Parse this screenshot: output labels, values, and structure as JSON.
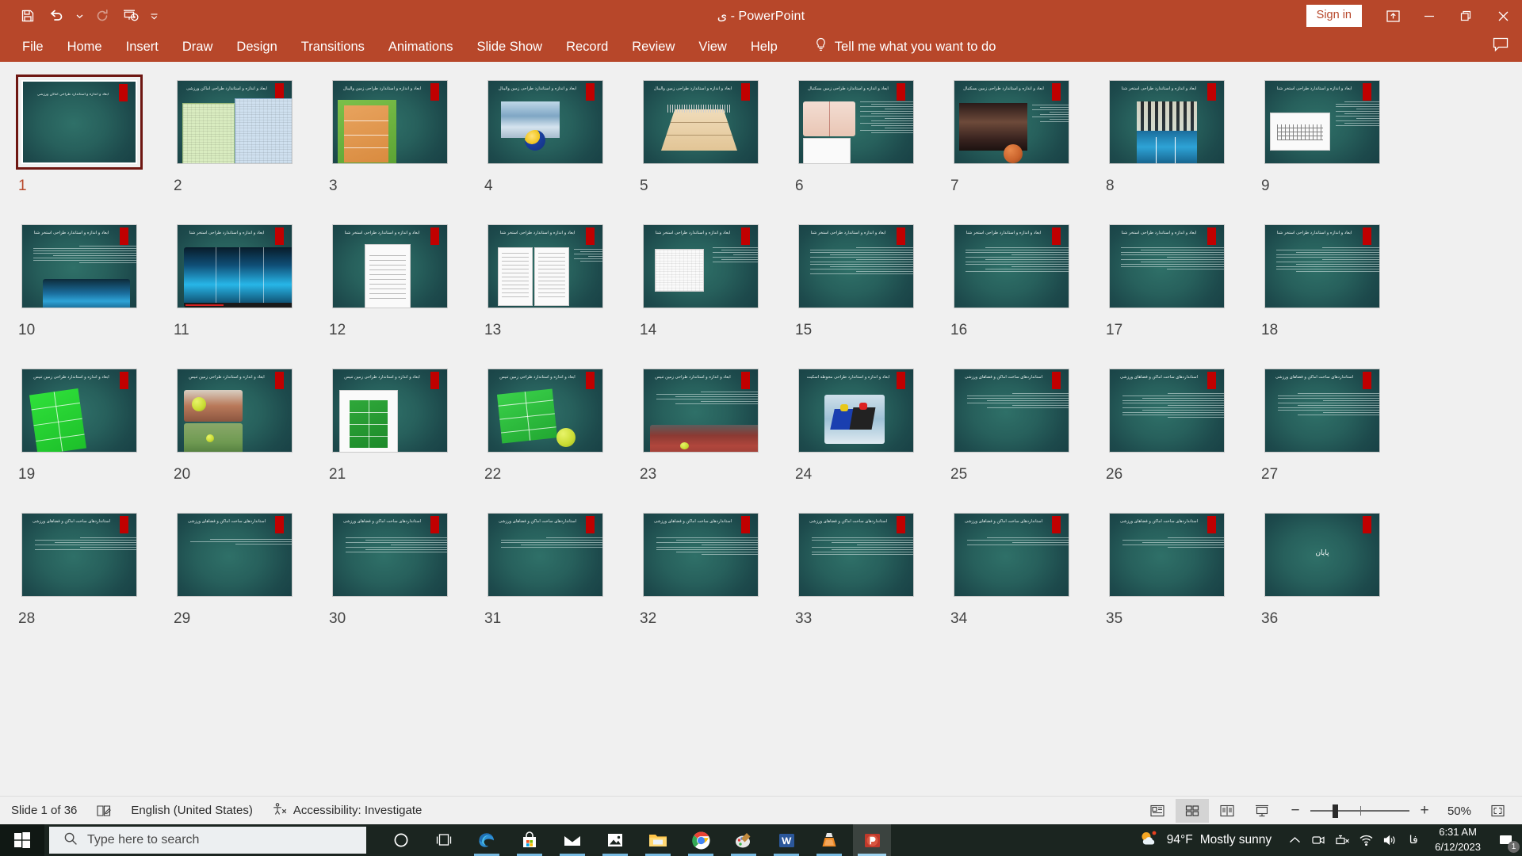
{
  "titlebar": {
    "document_title": "ى  -  PowerPoint",
    "signin_label": "Sign in",
    "qat": [
      {
        "name": "save-icon",
        "label": "Save"
      },
      {
        "name": "undo-icon",
        "label": "Undo"
      },
      {
        "name": "undo-dropdown-icon",
        "label": "Undo options"
      },
      {
        "name": "redo-icon",
        "label": "Redo"
      },
      {
        "name": "start-presentation-icon",
        "label": "Start From Beginning"
      },
      {
        "name": "customize-quick-access-toolbar-icon",
        "label": "Customize Quick Access Toolbar"
      }
    ],
    "window_controls": [
      {
        "name": "ribbon-display-options-icon",
        "label": "Ribbon Display Options"
      },
      {
        "name": "minimize-icon",
        "label": "Minimize"
      },
      {
        "name": "restore-icon",
        "label": "Restore Down"
      },
      {
        "name": "close-icon",
        "label": "Close"
      }
    ]
  },
  "ribbon": {
    "tabs": [
      {
        "label": "File"
      },
      {
        "label": "Home"
      },
      {
        "label": "Insert"
      },
      {
        "label": "Draw"
      },
      {
        "label": "Design"
      },
      {
        "label": "Transitions"
      },
      {
        "label": "Animations"
      },
      {
        "label": "Slide Show"
      },
      {
        "label": "Record"
      },
      {
        "label": "Review"
      },
      {
        "label": "View"
      },
      {
        "label": "Help"
      }
    ],
    "tell_me": "Tell me what you want to do",
    "comments_label": "Comments"
  },
  "sorter": {
    "selected_slide": 1,
    "slides": [
      {
        "num": "1",
        "title": "ابعاد و اندازه و استاندارد طراحی اماکن ورزشی",
        "kind": "title"
      },
      {
        "num": "2",
        "title": "ابعاد و اندازه و استاندارد طراحی اماکن ورزشی",
        "kind": "tables"
      },
      {
        "num": "3",
        "title": "ابعاد و اندازه و استاندارد طراحی زمین والیبال",
        "kind": "court-volley"
      },
      {
        "num": "4",
        "title": "ابعاد و اندازه و استاندارد طراحی زمین والیبال",
        "kind": "photo-volley"
      },
      {
        "num": "5",
        "title": "ابعاد و اندازه و استاندارد طراحی زمین والیبال",
        "kind": "court-3d"
      },
      {
        "num": "6",
        "title": "ابعاد و اندازه و استاندارد طراحی زمین بسکتبال",
        "kind": "basket-diagram"
      },
      {
        "num": "7",
        "title": "ابعاد و اندازه و استاندارد طراحی زمین بسکتبال",
        "kind": "basket-photo"
      },
      {
        "num": "8",
        "title": "ابعاد و اندازه و استاندارد طراحی استخر شنا",
        "kind": "pool-photo"
      },
      {
        "num": "9",
        "title": "ابعاد و اندازه و استاندارد طراحی استخر شنا",
        "kind": "pool-plan"
      },
      {
        "num": "10",
        "title": "ابعاد و اندازه و استاندارد طراحی استخر شنا",
        "kind": "pool-text"
      },
      {
        "num": "11",
        "title": "ابعاد و اندازه و استاندارد طراحی استخر شنا",
        "kind": "pool-photo2"
      },
      {
        "num": "12",
        "title": "ابعاد و اندازه و استاندارد طراحی استخر شنا",
        "kind": "doc-form"
      },
      {
        "num": "13",
        "title": "ابعاد و اندازه و استاندارد طراحی استخر شنا",
        "kind": "doc-pages"
      },
      {
        "num": "14",
        "title": "ابعاد و اندازه و استاندارد طراحی استخر شنا",
        "kind": "doc-chart"
      },
      {
        "num": "15",
        "title": "ابعاد و اندازه و استاندارد طراحی استخر شنا",
        "kind": "text"
      },
      {
        "num": "16",
        "title": "ابعاد و اندازه و استاندارد طراحی استخر شنا",
        "kind": "text"
      },
      {
        "num": "17",
        "title": "ابعاد و اندازه و استاندارد طراحی استخر شنا",
        "kind": "text"
      },
      {
        "num": "18",
        "title": "ابعاد و اندازه و استاندارد طراحی استخر شنا",
        "kind": "text"
      },
      {
        "num": "19",
        "title": "ابعاد و اندازه و استاندارد طراحی زمین تنیس",
        "kind": "tennis-court"
      },
      {
        "num": "20",
        "title": "ابعاد و اندازه و استاندارد طراحی زمین تنیس",
        "kind": "tennis-photos"
      },
      {
        "num": "21",
        "title": "ابعاد و اندازه و استاندارد طراحی زمین تنیس",
        "kind": "tennis-white"
      },
      {
        "num": "22",
        "title": "ابعاد و اندازه و استاندارد طراحی زمین تنیس",
        "kind": "tennis-ball"
      },
      {
        "num": "23",
        "title": "ابعاد و اندازه و استاندارد طراحی زمین تنیس",
        "kind": "tennis-track"
      },
      {
        "num": "24",
        "title": "ابعاد و اندازه و استاندارد طراحی محوطه اسکیت",
        "kind": "skate-photo"
      },
      {
        "num": "25",
        "title": "استانداردهای ساخت اماکن و فضاهای ورزشی",
        "kind": "text"
      },
      {
        "num": "26",
        "title": "استانداردهای ساخت اماکن و فضاهای ورزشی",
        "kind": "text"
      },
      {
        "num": "27",
        "title": "استانداردهای ساخت اماکن و فضاهای ورزشی",
        "kind": "text"
      },
      {
        "num": "28",
        "title": "استانداردهای ساخت اماکن و فضاهای ورزشی",
        "kind": "text"
      },
      {
        "num": "29",
        "title": "استانداردهای ساخت اماکن و فضاهای ورزشی",
        "kind": "text"
      },
      {
        "num": "30",
        "title": "استانداردهای ساخت اماکن و فضاهای ورزشی",
        "kind": "text"
      },
      {
        "num": "31",
        "title": "استانداردهای ساخت اماکن و فضاهای ورزشی",
        "kind": "text"
      },
      {
        "num": "32",
        "title": "استانداردهای ساخت اماکن و فضاهای ورزشی",
        "kind": "text"
      },
      {
        "num": "33",
        "title": "استانداردهای ساخت اماکن و فضاهای ورزشی",
        "kind": "text"
      },
      {
        "num": "34",
        "title": "استانداردهای ساخت اماکن و فضاهای ورزشی",
        "kind": "text"
      },
      {
        "num": "35",
        "title": "استانداردهای ساخت اماکن و فضاهای ورزشی",
        "kind": "text"
      },
      {
        "num": "36",
        "title": "",
        "kind": "end",
        "center_text": "پایان"
      }
    ]
  },
  "statusbar": {
    "slide_counter": "Slide 1 of 36",
    "notes_icon_label": "Notes",
    "language": "English (United States)",
    "accessibility": "Accessibility: Investigate",
    "views": [
      {
        "name": "normal-view-button",
        "label": "Normal",
        "active": false
      },
      {
        "name": "slide-sorter-view-button",
        "label": "Slide Sorter",
        "active": true
      },
      {
        "name": "reading-view-button",
        "label": "Reading View",
        "active": false
      },
      {
        "name": "slide-show-button",
        "label": "Slide Show",
        "active": false
      }
    ],
    "zoom_out_label": "−",
    "zoom_in_label": "+",
    "zoom_level": "50%",
    "fit_label": "Fit slide to current window"
  },
  "taskbar": {
    "search_placeholder": "Type here to search",
    "icons": [
      {
        "name": "cortana-icon",
        "label": "Cortana"
      },
      {
        "name": "task-view-icon",
        "label": "Task View"
      },
      {
        "name": "edge-icon",
        "label": "Microsoft Edge"
      },
      {
        "name": "microsoft-store-icon",
        "label": "Microsoft Store"
      },
      {
        "name": "mail-icon",
        "label": "Mail"
      },
      {
        "name": "photos-icon",
        "label": "Photos"
      },
      {
        "name": "file-explorer-icon",
        "label": "File Explorer"
      },
      {
        "name": "chrome-icon",
        "label": "Google Chrome"
      },
      {
        "name": "paint-icon",
        "label": "Paint"
      },
      {
        "name": "word-icon",
        "label": "Microsoft Word"
      },
      {
        "name": "vlc-icon",
        "label": "VLC media player"
      },
      {
        "name": "powerpoint-icon",
        "label": "Microsoft PowerPoint"
      }
    ],
    "weather_temp": "94°F",
    "weather_desc": "Mostly sunny",
    "tray_icons": [
      {
        "name": "show-hidden-icons-chevron",
        "label": "Show hidden icons"
      },
      {
        "name": "meet-now-icon",
        "label": "Meet Now"
      },
      {
        "name": "network-disconnected-icon",
        "label": "Network"
      },
      {
        "name": "wifi-icon",
        "label": "Wi-Fi"
      },
      {
        "name": "volume-icon",
        "label": "Volume"
      }
    ],
    "language_indicator": "فا",
    "clock_time": "6:31 AM",
    "clock_date": "6/12/2023",
    "notification_count": "1"
  }
}
